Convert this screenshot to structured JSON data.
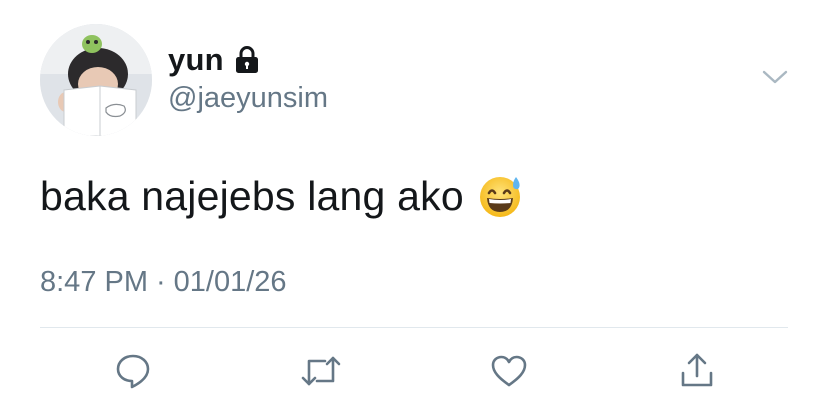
{
  "user": {
    "display_name": "yun",
    "handle": "@jaeyunsim",
    "protected_icon": "lock-icon",
    "avatar": "avatar"
  },
  "tweet": {
    "text": "baka najejebs lang ako",
    "emoji": "grinning-face-with-sweat-emoji",
    "time": "8:47 PM",
    "separator": "·",
    "date": "01/01/26"
  },
  "menu": {
    "icon": "chevron-down-icon"
  },
  "actions": [
    {
      "name": "reply",
      "icon": "reply-icon"
    },
    {
      "name": "retweet",
      "icon": "retweet-icon"
    },
    {
      "name": "like",
      "icon": "heart-icon"
    },
    {
      "name": "share",
      "icon": "share-icon"
    }
  ],
  "colors": {
    "primary_text": "#14171a",
    "secondary_text": "#657786",
    "icon": "#657786",
    "divider": "#e1e8ed"
  }
}
